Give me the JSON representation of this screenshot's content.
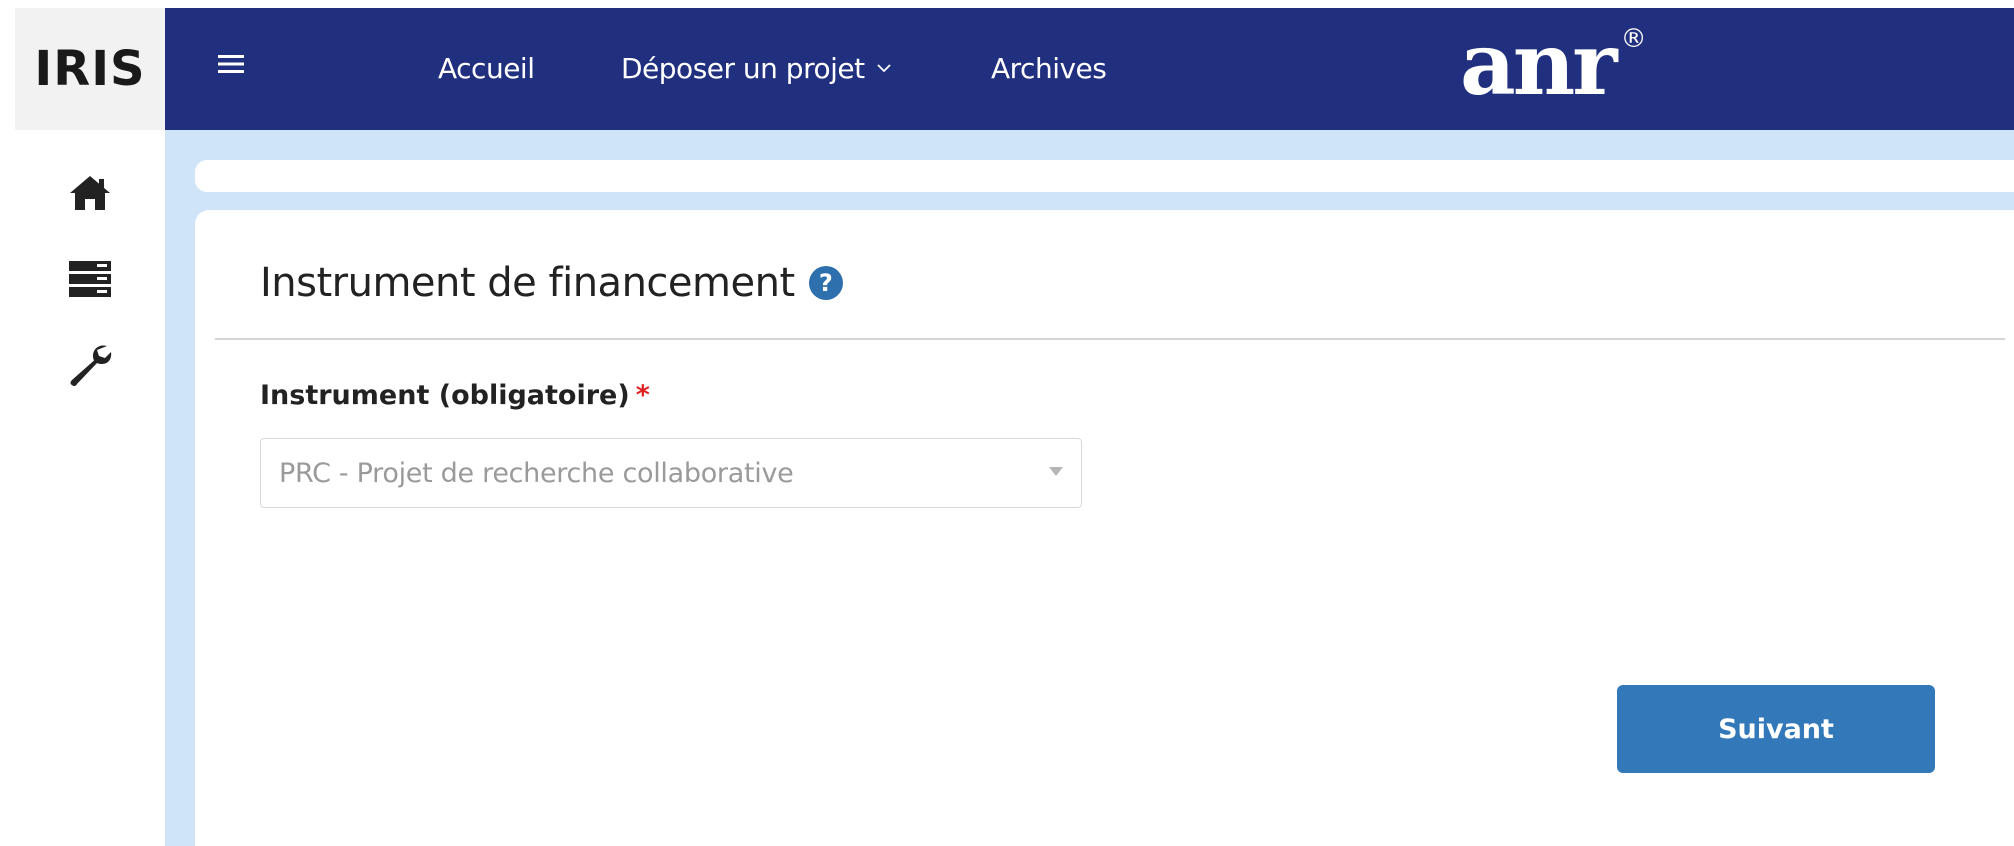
{
  "sidebar": {
    "brand": "IRIS",
    "items": [
      {
        "icon": "home-icon"
      },
      {
        "icon": "server-icon"
      },
      {
        "icon": "wrench-icon"
      }
    ]
  },
  "topbar": {
    "menu_icon": "hamburger-icon",
    "nav": {
      "home": "Accueil",
      "submit_project": "Déposer un projet",
      "archives": "Archives"
    },
    "logo_text": "anr",
    "logo_mark": "®"
  },
  "form": {
    "section_title": "Instrument de financement",
    "help_glyph": "?",
    "instrument_label": "Instrument (obligatoire)",
    "required_marker": "*",
    "instrument_value": "PRC - Projet de recherche collaborative",
    "next_button": "Suivant"
  },
  "colors": {
    "topbar": "#20307f",
    "content_bg": "#cfe4f7",
    "primary_button": "#3378b9",
    "help_icon": "#2e6fad",
    "required": "#e02020"
  }
}
